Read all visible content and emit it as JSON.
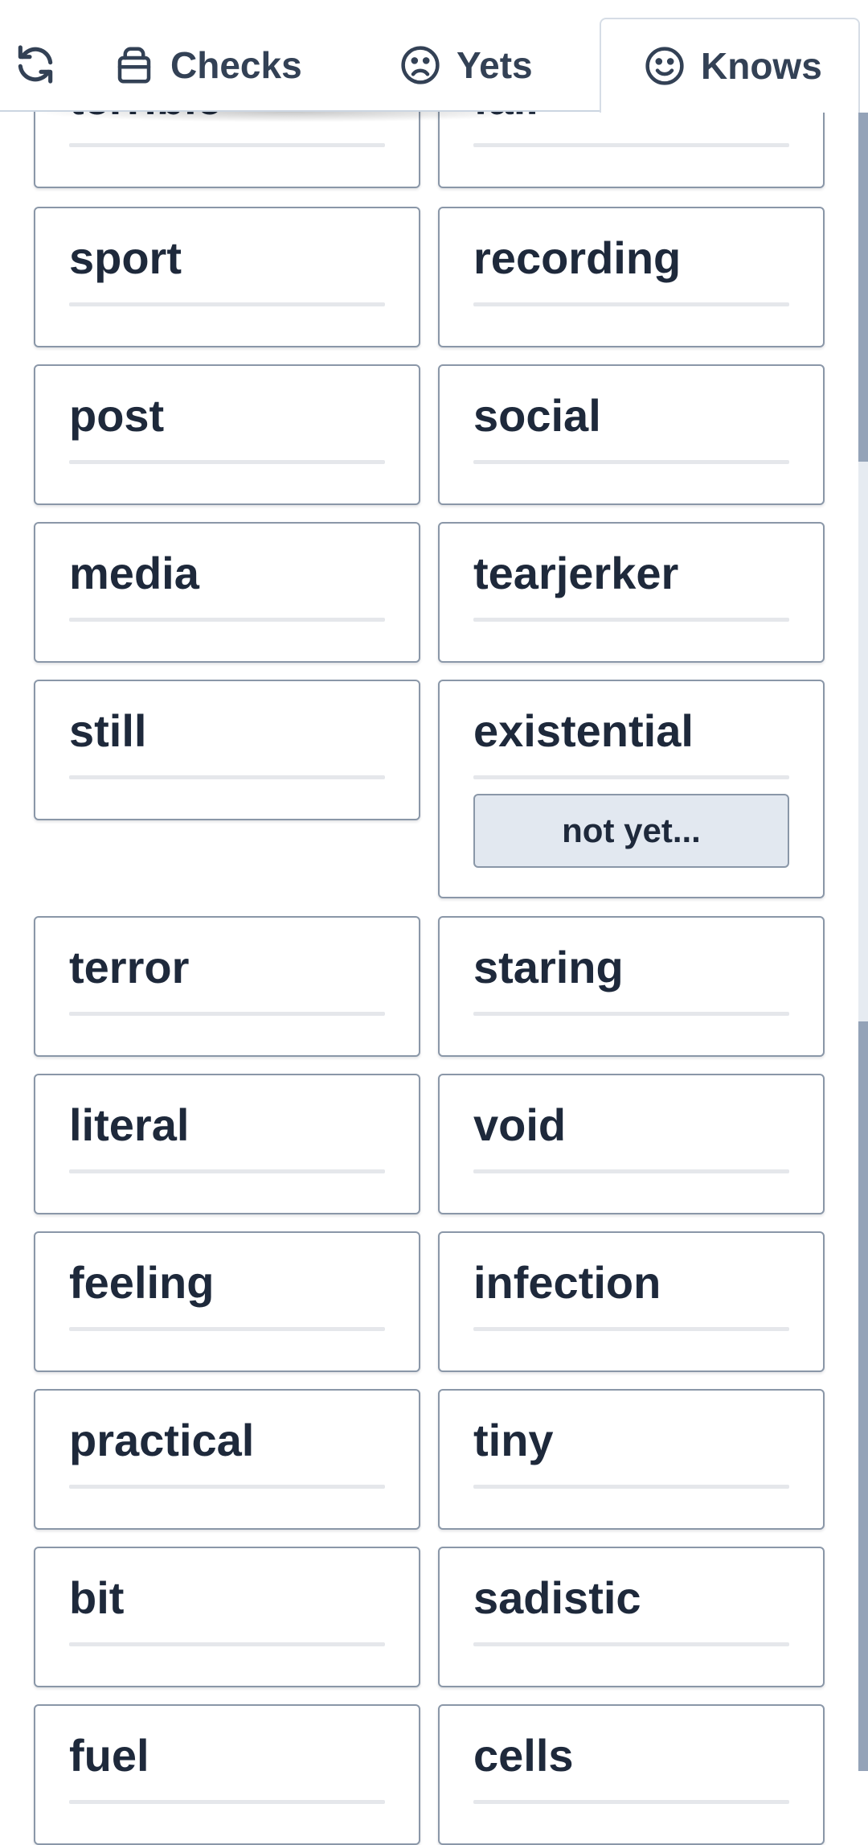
{
  "header": {
    "refresh_icon": "refresh-icon",
    "tabs": [
      {
        "label": "Checks",
        "icon": "basket-icon"
      },
      {
        "label": "Yets",
        "icon": "sad-face-icon"
      },
      {
        "label": "Knows",
        "icon": "smile-face-icon"
      }
    ],
    "active_tab": "Knows"
  },
  "cards": [
    {
      "word": "terrible"
    },
    {
      "word": "fall"
    },
    {
      "word": "sport"
    },
    {
      "word": "recording"
    },
    {
      "word": "post"
    },
    {
      "word": "social"
    },
    {
      "word": "media"
    },
    {
      "word": "tearjerker"
    },
    {
      "word": "still"
    },
    {
      "word": "existential",
      "button": "not yet..."
    },
    {
      "word": "terror"
    },
    {
      "word": "staring"
    },
    {
      "word": "literal"
    },
    {
      "word": "void"
    },
    {
      "word": "feeling"
    },
    {
      "word": "infection"
    },
    {
      "word": "practical"
    },
    {
      "word": "tiny"
    },
    {
      "word": "bit"
    },
    {
      "word": "sadistic"
    },
    {
      "word": "fuel"
    },
    {
      "word": "cells"
    }
  ],
  "colors": {
    "text": "#1e293b",
    "card_border": "#8a97a8",
    "button_bg": "#e2e8f0",
    "scrollbar": "#94a3b8"
  }
}
